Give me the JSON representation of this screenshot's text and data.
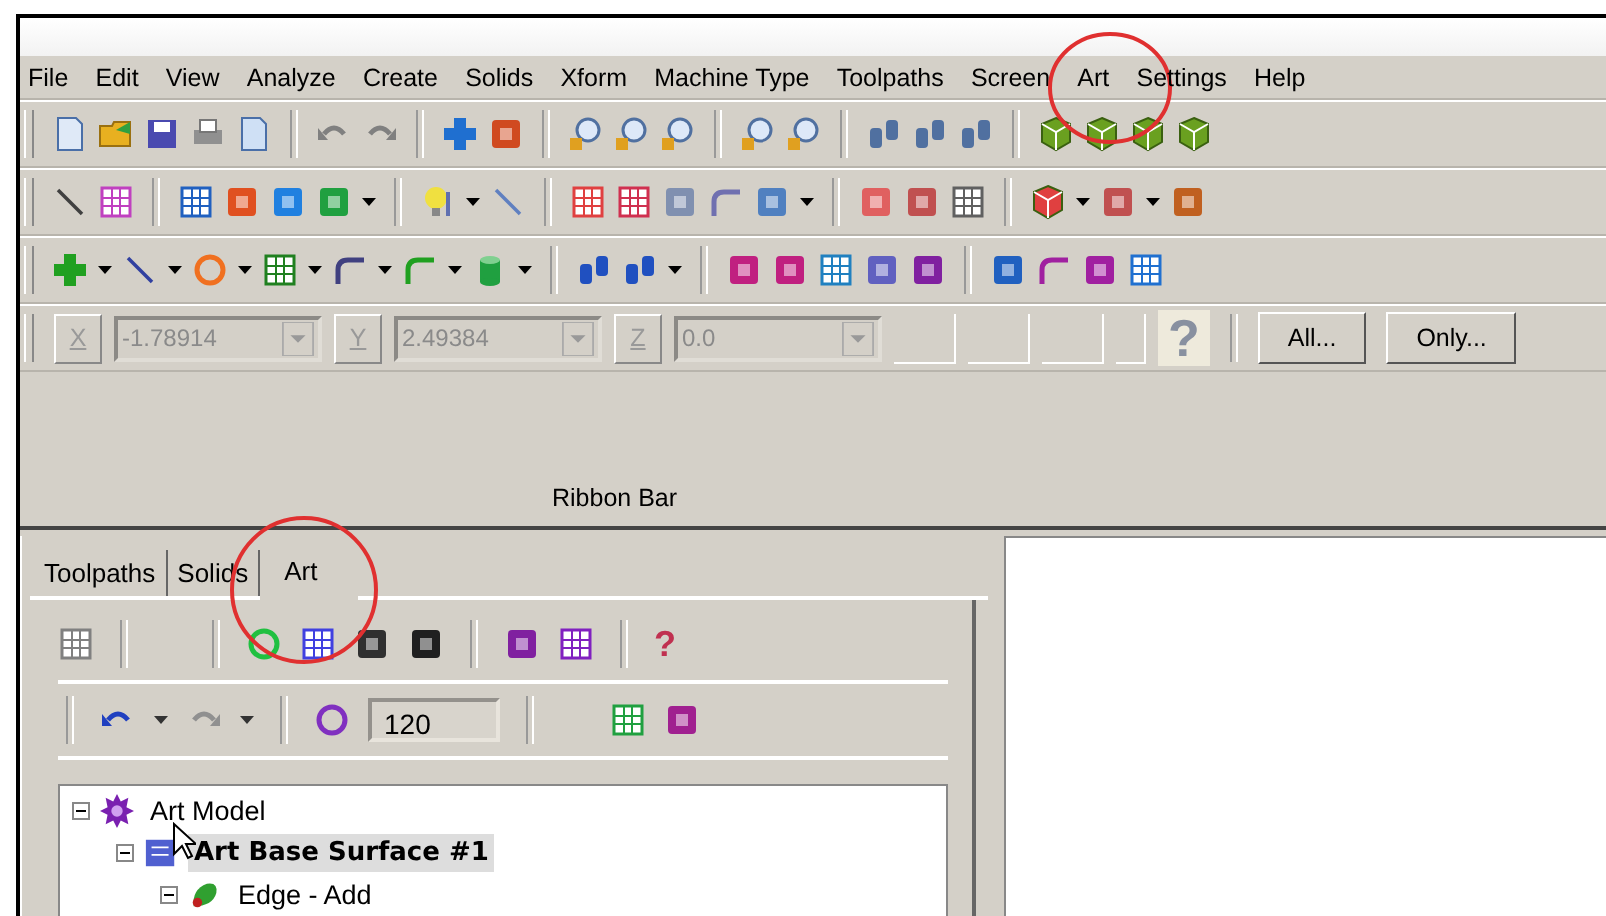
{
  "menu": [
    {
      "label": "File"
    },
    {
      "label": "Edit"
    },
    {
      "label": "View"
    },
    {
      "label": "Analyze"
    },
    {
      "label": "Create"
    },
    {
      "label": "Solids"
    },
    {
      "label": "Xform"
    },
    {
      "label": "Machine Type"
    },
    {
      "label": "Toolpaths"
    },
    {
      "label": "Screen"
    },
    {
      "label": "Art",
      "circled": true
    },
    {
      "label": "Settings"
    },
    {
      "label": "Help"
    }
  ],
  "toolbars": [
    {
      "items": [
        {
          "kind": "page",
          "color": "#dfe9f7"
        },
        {
          "kind": "folder",
          "color": "#e8b020"
        },
        {
          "kind": "disk",
          "color": "#4a4ab0"
        },
        {
          "kind": "printer",
          "color": "#909090"
        },
        {
          "kind": "page",
          "color": "#cfe0f5"
        },
        {
          "kind": "sep"
        },
        {
          "kind": "undo",
          "color": "#808080"
        },
        {
          "kind": "redo",
          "color": "#808080"
        },
        {
          "kind": "sep"
        },
        {
          "kind": "plus",
          "color": "#1f6fd0"
        },
        {
          "kind": "square",
          "color": "#d04a20"
        },
        {
          "kind": "sep"
        },
        {
          "kind": "lens",
          "color": "#e0a020"
        },
        {
          "kind": "lens",
          "color": "#e0a020"
        },
        {
          "kind": "lens",
          "color": "#e0a020"
        },
        {
          "kind": "sep"
        },
        {
          "kind": "lens",
          "color": "#e0a020"
        },
        {
          "kind": "lens",
          "color": "#e0a020"
        },
        {
          "kind": "sep"
        },
        {
          "kind": "tube",
          "color": "#5070a0"
        },
        {
          "kind": "tube",
          "color": "#5070a0"
        },
        {
          "kind": "tube",
          "color": "#5070a0"
        },
        {
          "kind": "sep"
        },
        {
          "kind": "cube",
          "color": "#6aa020"
        },
        {
          "kind": "cube",
          "color": "#6aa020"
        },
        {
          "kind": "cube",
          "color": "#6aa020"
        },
        {
          "kind": "cube",
          "color": "#6aa020"
        }
      ]
    },
    {
      "items": [
        {
          "kind": "line",
          "color": "#404040"
        },
        {
          "kind": "grid",
          "color": "#c040c0"
        },
        {
          "kind": "sep"
        },
        {
          "kind": "grid",
          "color": "#2060c0"
        },
        {
          "kind": "square",
          "color": "#e05020"
        },
        {
          "kind": "square",
          "color": "#2080e0"
        },
        {
          "kind": "square",
          "color": "#20a040"
        },
        {
          "kind": "drop"
        },
        {
          "kind": "sep"
        },
        {
          "kind": "bulb",
          "color": "#f0e040"
        },
        {
          "kind": "drop"
        },
        {
          "kind": "line",
          "color": "#6080c0"
        },
        {
          "kind": "sep"
        },
        {
          "kind": "grid",
          "color": "#e04040"
        },
        {
          "kind": "grid",
          "color": "#d03050"
        },
        {
          "kind": "square",
          "color": "#8090b0"
        },
        {
          "kind": "curve",
          "color": "#7070b0"
        },
        {
          "kind": "square",
          "color": "#5080c0"
        },
        {
          "kind": "drop"
        },
        {
          "kind": "sep"
        },
        {
          "kind": "square",
          "color": "#e06060"
        },
        {
          "kind": "square",
          "color": "#c05050"
        },
        {
          "kind": "grid",
          "color": "#606060"
        },
        {
          "kind": "sep"
        },
        {
          "kind": "cube",
          "color": "#e04040"
        },
        {
          "kind": "drop"
        },
        {
          "kind": "square",
          "color": "#c05050"
        },
        {
          "kind": "drop"
        },
        {
          "kind": "square",
          "color": "#c06020"
        }
      ]
    },
    {
      "items": [
        {
          "kind": "plus",
          "color": "#20a020"
        },
        {
          "kind": "drop"
        },
        {
          "kind": "line",
          "color": "#3040a0"
        },
        {
          "kind": "drop"
        },
        {
          "kind": "circle",
          "color": "#f07020"
        },
        {
          "kind": "drop"
        },
        {
          "kind": "grid",
          "color": "#208020"
        },
        {
          "kind": "drop"
        },
        {
          "kind": "curve",
          "color": "#404080"
        },
        {
          "kind": "drop"
        },
        {
          "kind": "curve",
          "color": "#20a020"
        },
        {
          "kind": "drop"
        },
        {
          "kind": "cylinder",
          "color": "#20a040"
        },
        {
          "kind": "drop"
        },
        {
          "kind": "sep"
        },
        {
          "kind": "tube",
          "color": "#2050c0"
        },
        {
          "kind": "tube",
          "color": "#2050c0"
        },
        {
          "kind": "drop"
        },
        {
          "kind": "sep"
        },
        {
          "kind": "square",
          "color": "#c02080"
        },
        {
          "kind": "square",
          "color": "#c02080"
        },
        {
          "kind": "grid",
          "color": "#2080c0"
        },
        {
          "kind": "square",
          "color": "#6060c0"
        },
        {
          "kind": "square",
          "color": "#8020a0"
        },
        {
          "kind": "sep"
        },
        {
          "kind": "square",
          "color": "#2060c0"
        },
        {
          "kind": "curve",
          "color": "#a020a0"
        },
        {
          "kind": "square",
          "color": "#a020a0"
        },
        {
          "kind": "grid",
          "color": "#2070d0"
        }
      ]
    }
  ],
  "coordinates": [
    {
      "label": "X",
      "value": "-1.78914",
      "dropdown": true,
      "disabled": true
    },
    {
      "label": "Y",
      "value": "2.49384",
      "dropdown": true,
      "disabled": true
    },
    {
      "label": "Z",
      "value": "0.0",
      "dropdown": true,
      "disabled": true
    }
  ],
  "help_glyph": "?",
  "buttons": [
    "All...",
    "Only..."
  ],
  "ribbon_label": "Ribbon Bar",
  "panel": {
    "tabs": [
      {
        "label": "Toolpaths",
        "selected": false
      },
      {
        "label": "Solids",
        "selected": false
      },
      {
        "label": "Art",
        "selected": true,
        "circled": true
      }
    ],
    "toolbars": [
      {
        "items": [
          {
            "kind": "grid",
            "color": "#808080"
          },
          {
            "kind": "sep"
          },
          {
            "kind": "gap"
          },
          {
            "kind": "sep"
          },
          {
            "kind": "circle",
            "color": "#20c040"
          },
          {
            "kind": "grid",
            "color": "#4040e0"
          },
          {
            "kind": "square",
            "color": "#303030"
          },
          {
            "kind": "square",
            "color": "#202020"
          },
          {
            "kind": "sep"
          },
          {
            "kind": "square",
            "color": "#8020a0"
          },
          {
            "kind": "grid",
            "color": "#8020c0"
          },
          {
            "kind": "sep"
          },
          {
            "kind": "glyph",
            "text": "?"
          }
        ]
      },
      {
        "items": [
          {
            "kind": "sep"
          },
          {
            "kind": "undo",
            "color": "#2040c0"
          },
          {
            "kind": "drop"
          },
          {
            "kind": "redo",
            "color": "#909090"
          },
          {
            "kind": "drop"
          },
          {
            "kind": "sep"
          },
          {
            "kind": "circle",
            "color": "#8030c0"
          },
          {
            "kind": "field",
            "value": "120"
          },
          {
            "kind": "sep"
          },
          {
            "kind": "gap"
          },
          {
            "kind": "grid",
            "color": "#20a040"
          },
          {
            "kind": "square",
            "color": "#a02090"
          }
        ]
      }
    ],
    "tree": [
      {
        "label": "Art Model",
        "kind": "gear",
        "expanded": true,
        "selected": false,
        "children": [
          {
            "label": "Art Base Surface #1",
            "kind": "surface",
            "expanded": true,
            "selected": true,
            "children": [
              {
                "label": "Edge - Add",
                "kind": "leaf",
                "expanded": true,
                "selected": false
              }
            ]
          }
        ]
      }
    ]
  }
}
